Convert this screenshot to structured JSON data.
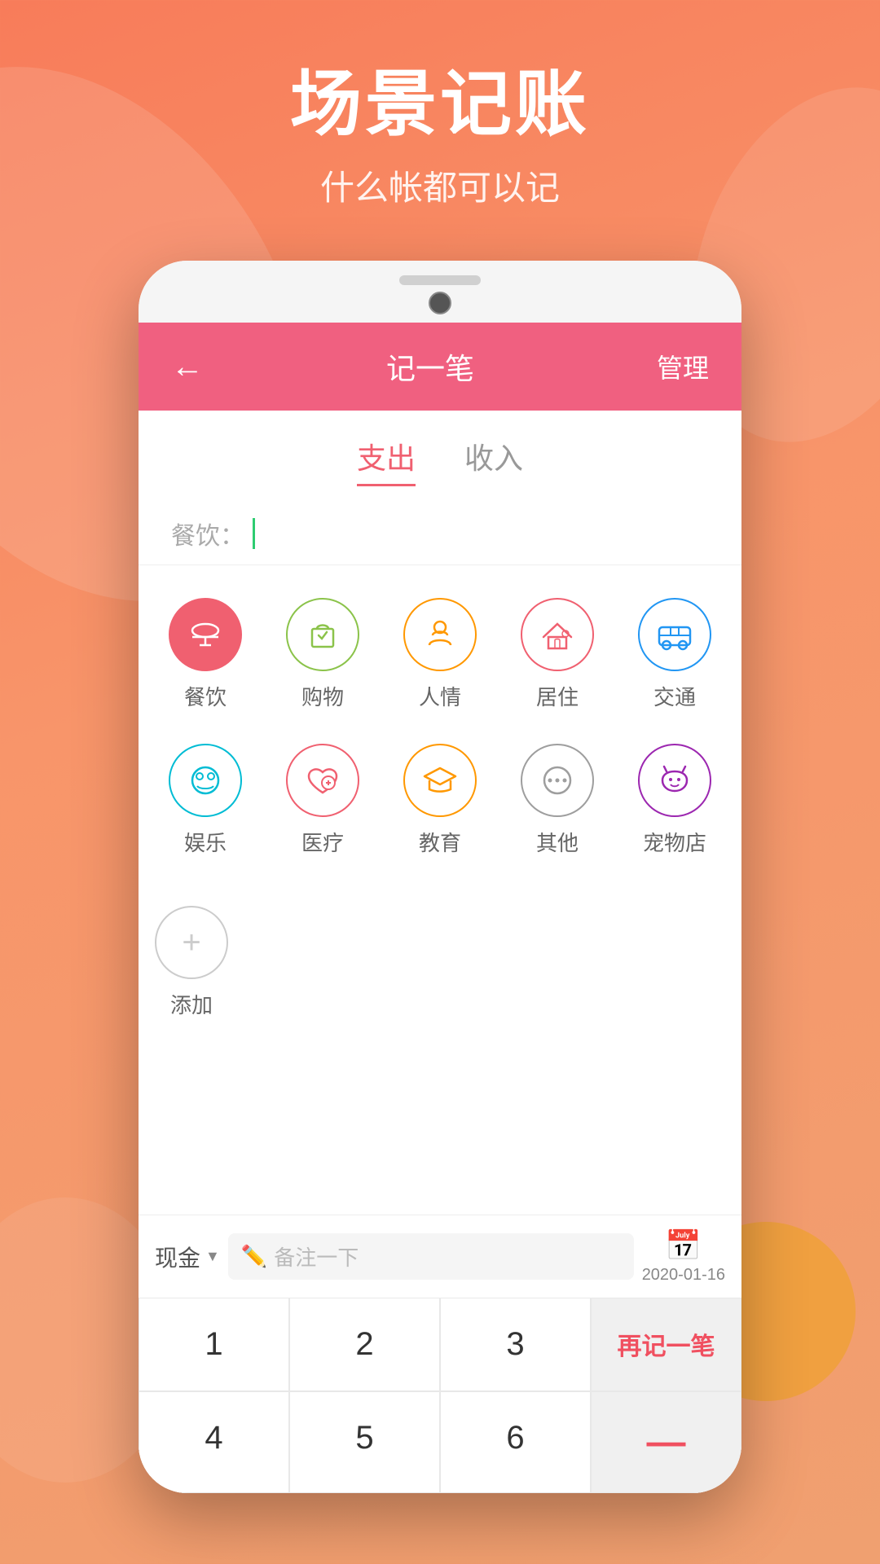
{
  "background": {
    "gradient_start": "#f87c5a",
    "gradient_end": "#f0a070"
  },
  "header": {
    "main_title": "场景记账",
    "sub_title": "什么帐都可以记"
  },
  "phone": {
    "app_header": {
      "back_label": "←",
      "title": "记一笔",
      "manage_label": "管理"
    },
    "tabs": [
      {
        "label": "支出",
        "active": true
      },
      {
        "label": "收入",
        "active": false
      }
    ],
    "input_section": {
      "category_prefix": "餐饮：",
      "placeholder": ""
    },
    "categories": [
      {
        "id": "dining",
        "label": "餐饮",
        "icon": "🍽",
        "selected": true
      },
      {
        "id": "shopping",
        "label": "购物",
        "icon": "🛍",
        "selected": false
      },
      {
        "id": "relations",
        "label": "人情",
        "icon": "👨‍👩‍👧",
        "selected": false
      },
      {
        "id": "housing",
        "label": "居住",
        "icon": "🏠",
        "selected": false
      },
      {
        "id": "transport",
        "label": "交通",
        "icon": "🚌",
        "selected": false
      },
      {
        "id": "entertainment",
        "label": "娱乐",
        "icon": "🎮",
        "selected": false
      },
      {
        "id": "medical",
        "label": "医疗",
        "icon": "❤",
        "selected": false
      },
      {
        "id": "education",
        "label": "教育",
        "icon": "🎓",
        "selected": false
      },
      {
        "id": "other",
        "label": "其他",
        "icon": "⋯",
        "selected": false
      },
      {
        "id": "pet",
        "label": "宠物店",
        "icon": "🐱",
        "selected": false
      }
    ],
    "add_category": {
      "label": "添加",
      "icon": "+"
    },
    "footer": {
      "payment_method": "现金",
      "dropdown_arrow": "▼",
      "note_placeholder": "备注一下",
      "calendar_icon": "📅",
      "date": "2020-01-16"
    },
    "numpad": {
      "keys": [
        [
          "1",
          "2",
          "3",
          "再记一笔"
        ],
        [
          "4",
          "5",
          "6",
          "—"
        ]
      ]
    }
  }
}
